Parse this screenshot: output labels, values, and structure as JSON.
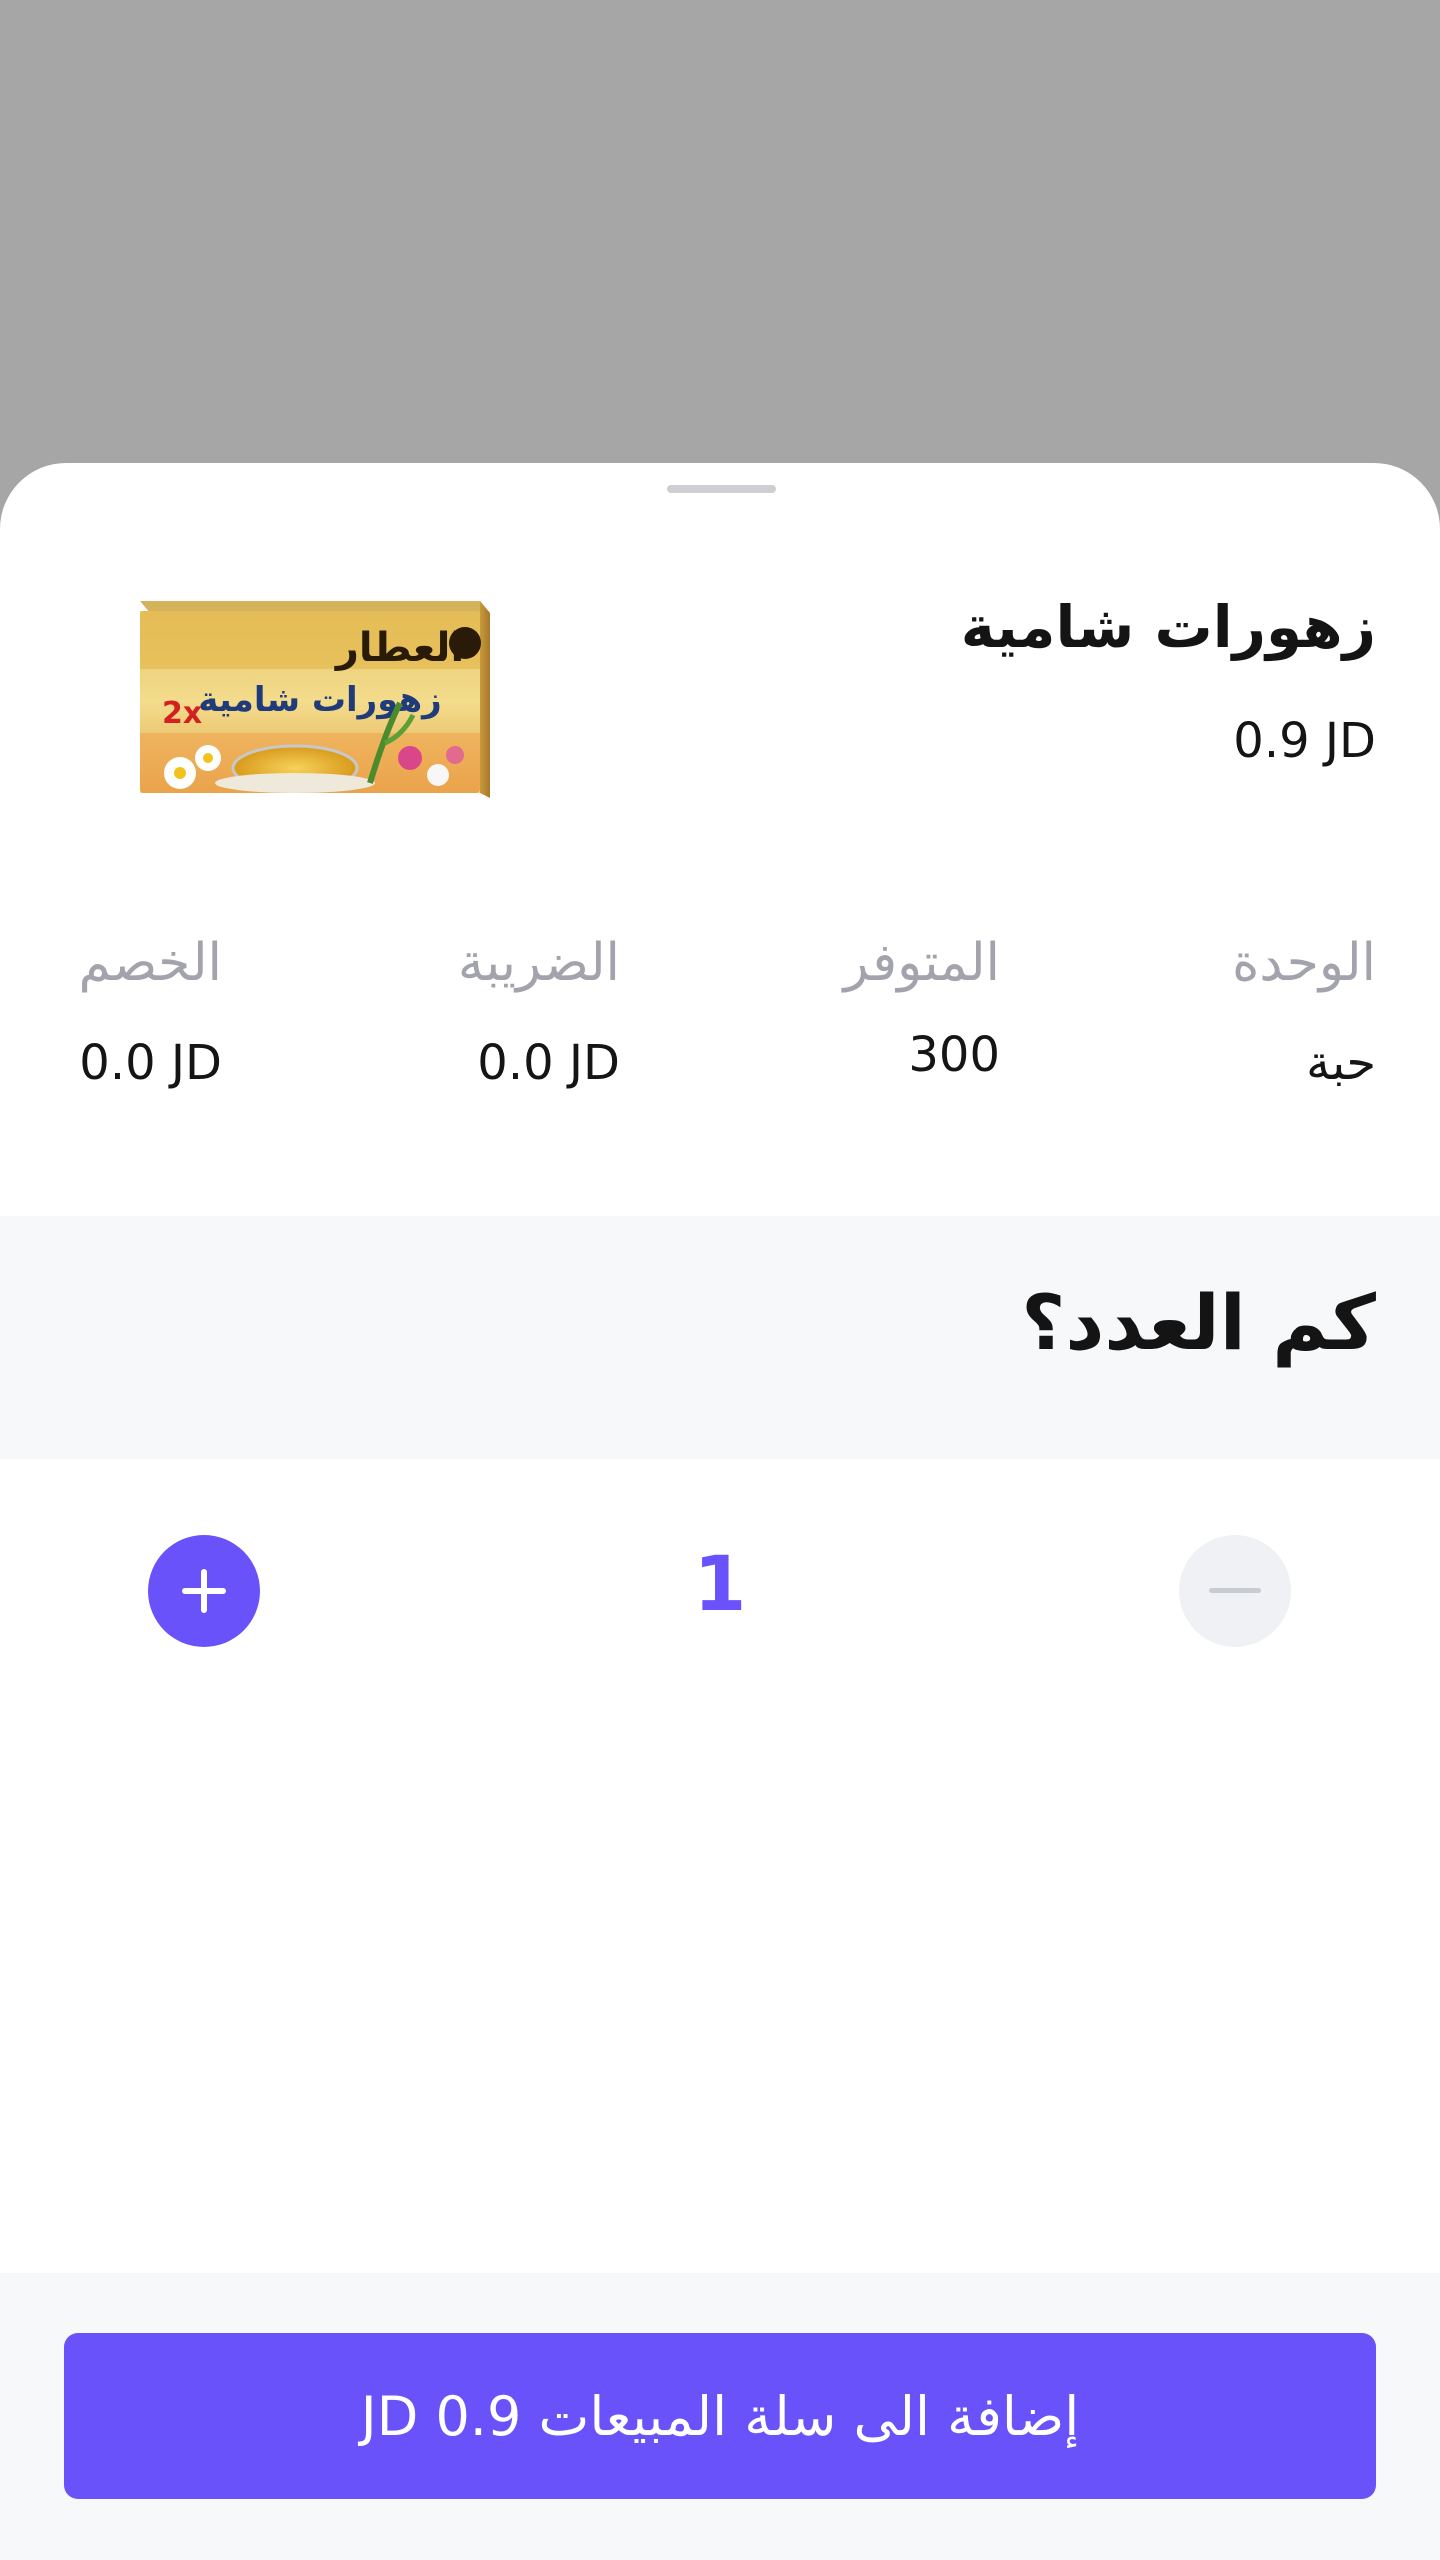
{
  "product": {
    "name": "زهورات شامية",
    "price": "0.9 JD",
    "image_box_text": {
      "brand": "العطار",
      "title": "زهورات شامية"
    }
  },
  "stats": {
    "unit": {
      "label": "الوحدة",
      "value": "حبة"
    },
    "available": {
      "label": "المتوفر",
      "value": "300"
    },
    "tax": {
      "label": "الضريبة",
      "value": "0.0 JD"
    },
    "discount": {
      "label": "الخصم",
      "value": "0.0 JD"
    }
  },
  "quantity": {
    "question": "كم العدد؟",
    "value": "1",
    "plus_icon": "plus-icon",
    "minus_icon": "minus-icon"
  },
  "cta": {
    "label": "إضافة الى سلة المبيعات 0.9 JD"
  },
  "colors": {
    "accent": "#6a52fb",
    "scrim": "#a6a6a6",
    "muted_label": "#a3a3ad",
    "band": "#f7f8fa"
  }
}
